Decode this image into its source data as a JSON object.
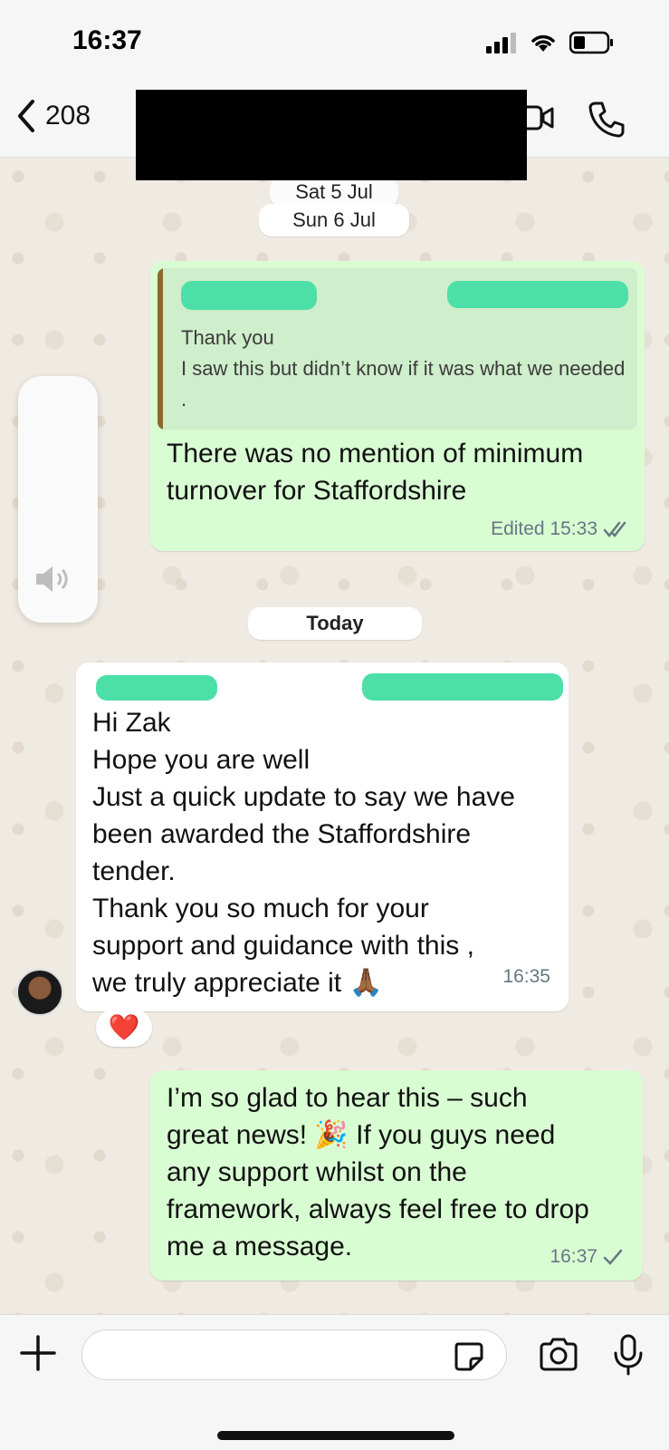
{
  "status_bar": {
    "time": "16:37"
  },
  "header": {
    "back_count": "208"
  },
  "chat": {
    "date_pills": [
      "Sat 5 Jul",
      "Sun 6 Jul",
      "Today"
    ],
    "messages": [
      {
        "direction": "outgoing",
        "quoted_text": "Thank you\nI saw this but didn’t know if it was what we needed .",
        "text": "There was no mention of minimum\nturnover for Staffordshire",
        "meta": "Edited 15:33",
        "status": "read"
      },
      {
        "direction": "incoming",
        "text": "Hi Zak\nHope you are well\nJust a quick update to say we have\nbeen awarded the Staffordshire\ntender.\nThank you so much for your\nsupport and guidance with this ,\nwe truly appreciate it 🙏🏾",
        "time": "16:35",
        "reaction": "❤️"
      },
      {
        "direction": "outgoing",
        "text": "I’m so glad to hear this – such\ngreat news! 🎉 If you guys need\nany support whilst on the\nframework, always feel free to drop\nme a message.",
        "time": "16:37",
        "status": "sent"
      }
    ]
  },
  "colors": {
    "outgoing_bubble": "#d9fdd3",
    "incoming_bubble": "#ffffff",
    "accent": "#25d366"
  },
  "icons": [
    "back-chevron-icon",
    "video-call-icon",
    "phone-icon",
    "volume-icon",
    "plus-icon",
    "sticker-icon",
    "camera-icon",
    "microphone-icon"
  ]
}
